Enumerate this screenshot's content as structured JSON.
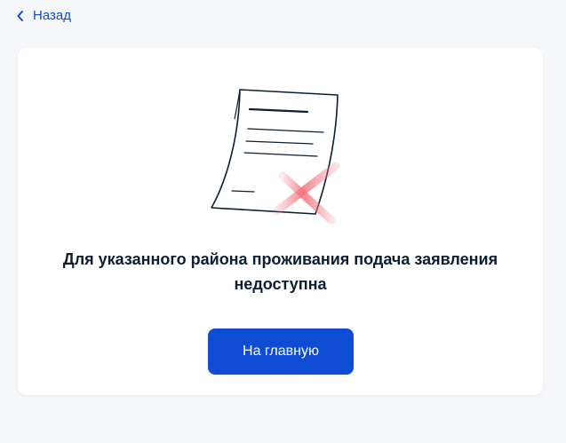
{
  "header": {
    "back_label": "Назад"
  },
  "card": {
    "message": "Для указанного района проживания подача заявления недоступна",
    "home_button_label": "На главную",
    "illustration_icon": "document-rejected-icon"
  },
  "colors": {
    "accent": "#0d4cd3",
    "background": "#f5f7fa",
    "card": "#ffffff",
    "text": "#0b1f33",
    "reject_mark": "#f2737e"
  }
}
